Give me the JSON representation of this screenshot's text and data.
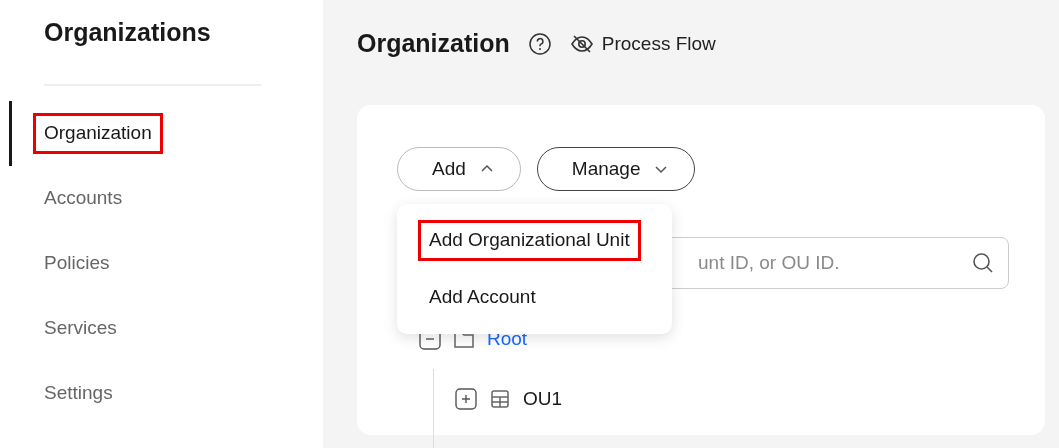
{
  "sidebar": {
    "title": "Organizations",
    "items": [
      {
        "label": "Organization",
        "selected": true,
        "highlighted": true
      },
      {
        "label": "Accounts",
        "selected": false,
        "highlighted": false
      },
      {
        "label": "Policies",
        "selected": false,
        "highlighted": false
      },
      {
        "label": "Services",
        "selected": false,
        "highlighted": false
      },
      {
        "label": "Settings",
        "selected": false,
        "highlighted": false
      }
    ]
  },
  "header": {
    "title": "Organization",
    "process_flow": "Process Flow"
  },
  "toolbar": {
    "buttons": [
      {
        "label": "Add",
        "expanded": true
      },
      {
        "label": "Manage",
        "expanded": false
      }
    ]
  },
  "add_menu": {
    "items": [
      {
        "label": "Add Organizational Unit",
        "highlighted": true
      },
      {
        "label": "Add Account",
        "highlighted": false
      }
    ]
  },
  "search": {
    "placeholder": "unt ID, or OU ID."
  },
  "tree": [
    {
      "label": "Root",
      "kind": "root",
      "expanded": true,
      "selected": true,
      "children": [
        {
          "label": "OU1",
          "kind": "ou",
          "expanded": false,
          "selected": false
        }
      ]
    }
  ]
}
